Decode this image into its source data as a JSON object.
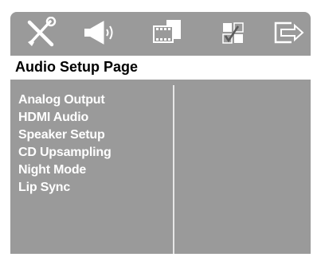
{
  "icon_bar": {
    "items": [
      {
        "icon": "settings-tools-icon"
      },
      {
        "icon": "speaker-icon"
      },
      {
        "icon": "video-film-icon"
      },
      {
        "icon": "preferences-checkbox-icon"
      },
      {
        "icon": "exit-icon"
      }
    ]
  },
  "page": {
    "title": "Audio Setup Page"
  },
  "menu": {
    "items": [
      {
        "label": "Analog Output"
      },
      {
        "label": "HDMI Audio"
      },
      {
        "label": "Speaker Setup"
      },
      {
        "label": "CD Upsampling"
      },
      {
        "label": "Night Mode"
      },
      {
        "label": "Lip Sync"
      }
    ]
  },
  "colors": {
    "panel_background": "#9a9a9a",
    "title_bar_background": "#ffffff",
    "menu_text": "#ffffff",
    "title_text": "#000000"
  }
}
